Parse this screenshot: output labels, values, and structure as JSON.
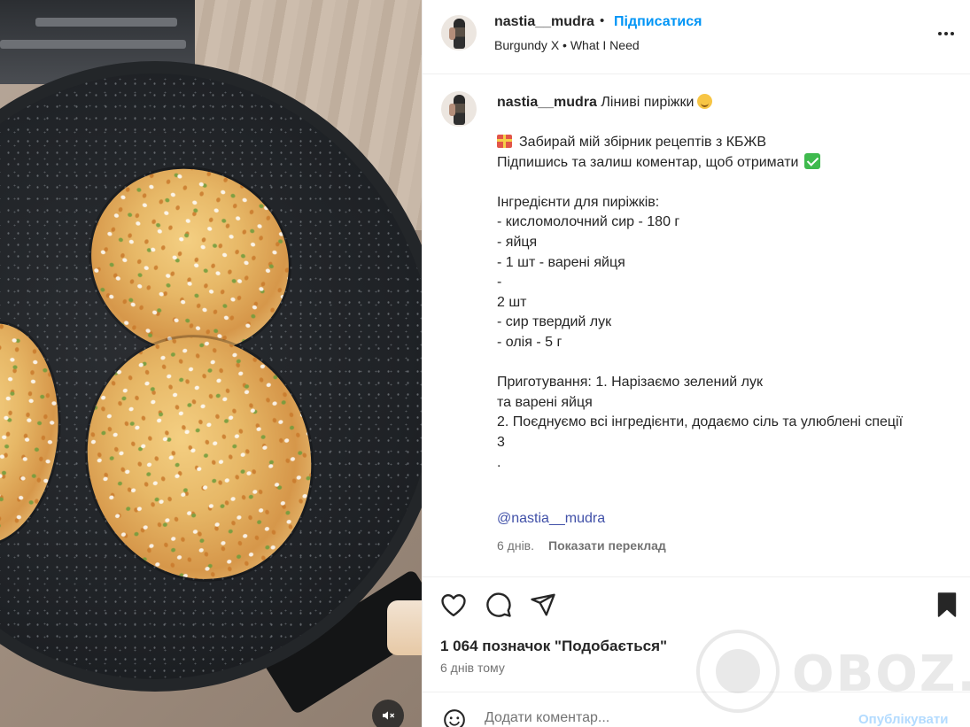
{
  "post": {
    "username": "nastia__mudra",
    "follow_label": "Підписатися",
    "separator": "•",
    "music": "Burgundy X • What I Need"
  },
  "caption": {
    "username": "nastia__mudra",
    "title": "Ліниві пиріжки",
    "lines": [
      "Забирай мій збірник рецептів з КБЖВ",
      "Підпишись та залиш коментар, щоб отримати",
      "",
      "Інгредієнти для пиріжків:",
      "- кисломолочний сир - 180 г",
      "- яйця",
      "- 1 шт - варені яйця",
      "-",
      "2 шт",
      "- сир твердий лук",
      "- олія - 5 г",
      "",
      "Приготування: 1. Нарізаємо зелений лук",
      "та варені яйця",
      "2. Поєднуємо всі інгредієнти, додаємо сіль та улюблені спеції",
      "3",
      "."
    ],
    "mention": "@nastia__mudra",
    "age": "6 днів.",
    "translate_label": "Показати переклад"
  },
  "actions": {
    "likes_text": "1 064 позначок \"Подобається\"",
    "date": "6 днів тому"
  },
  "comment": {
    "placeholder": "Додати коментар...",
    "publish_label": "Опублікувати"
  },
  "watermark": {
    "text": "OBOZ.UA"
  },
  "colors": {
    "link_blue": "#0095f6",
    "mention": "#4050a8",
    "muted": "#737373",
    "publish_disabled": "#b3dbff"
  },
  "icons": {
    "like": "heart-icon",
    "comment": "comment-icon",
    "share": "paper-plane-icon",
    "save": "bookmark-icon",
    "more": "more-options-icon",
    "emoji": "emoji-icon",
    "mute": "sound-off-icon"
  }
}
